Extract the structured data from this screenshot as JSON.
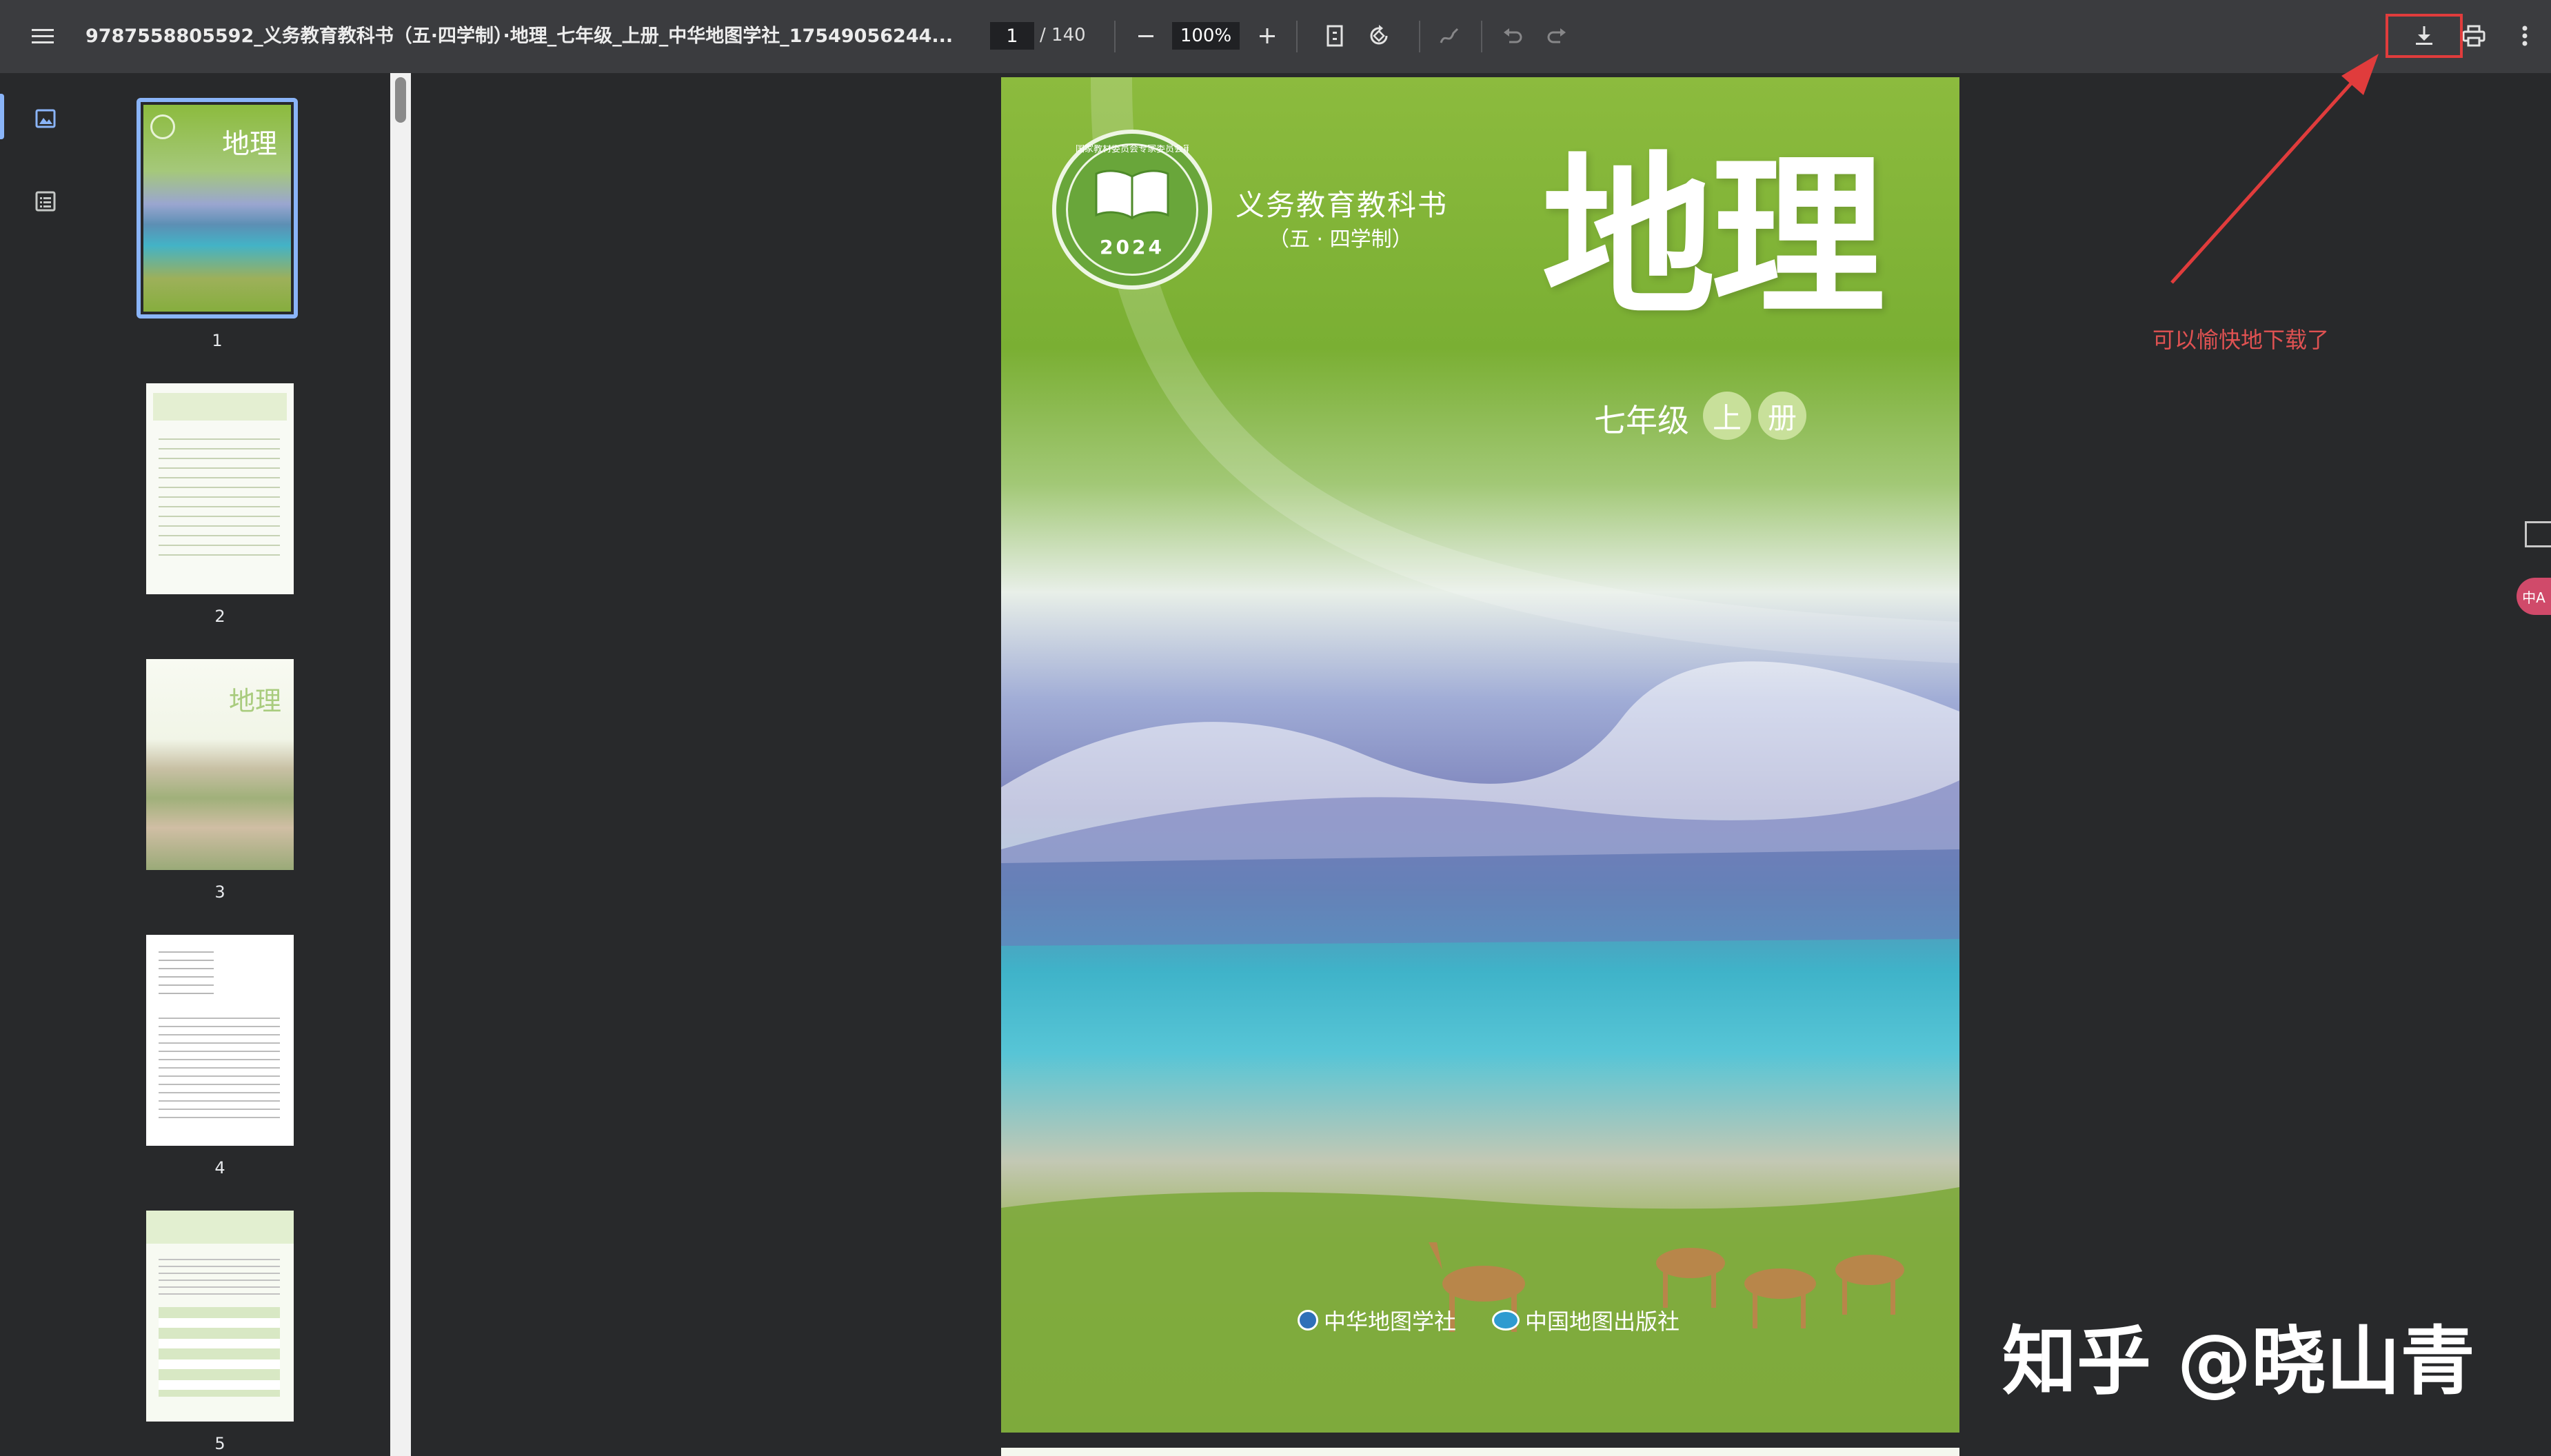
{
  "toolbar": {
    "title": "9787558805592_义务教育教科书（五·四学制）·地理_七年级_上册_中华地图学社_17549056244...",
    "page_current": "1",
    "page_total": "/ 140",
    "zoom": "100%"
  },
  "thumbnails": [
    {
      "number": "1",
      "cover_title": "地理"
    },
    {
      "number": "2"
    },
    {
      "number": "3",
      "cover_title": "地理"
    },
    {
      "number": "4"
    },
    {
      "number": "5"
    }
  ],
  "cover": {
    "seal_text": "国家教材委员会专家委员会审核通过",
    "seal_year": "2024",
    "series": "义务教育教科书",
    "system": "（五 · 四学制）",
    "subject": "地理",
    "grade": "七年级",
    "vol_1": "上",
    "vol_2": "册",
    "publisher_1": "中华地图学社",
    "publisher_2": "中国地图出版社"
  },
  "annotation": {
    "text": "可以愉快地下载了",
    "color": "#e05252"
  },
  "watermark": "知乎 @晓山青",
  "side_widgets": {
    "translate_label": "中A"
  }
}
